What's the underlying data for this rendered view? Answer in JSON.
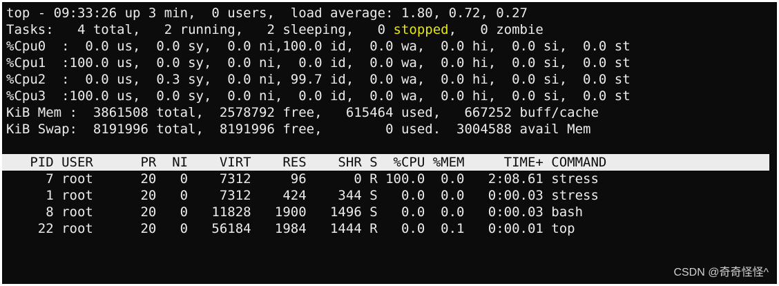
{
  "summary": {
    "line1": "top - 09:33:26 up 3 min,  0 users,  load average: 1.80, 0.72, 0.27",
    "tasks_pre": "Tasks:   4 total,   2 running,   2 sleeping,   0 ",
    "tasks_stopped": "stopped",
    "tasks_post": ",   0 zombie",
    "cpu": [
      "%Cpu0  :  0.0 us,  0.0 sy,  0.0 ni,100.0 id,  0.0 wa,  0.0 hi,  0.0 si,  0.0 st",
      "%Cpu1  :100.0 us,  0.0 sy,  0.0 ni,  0.0 id,  0.0 wa,  0.0 hi,  0.0 si,  0.0 st",
      "%Cpu2  :  0.0 us,  0.3 sy,  0.0 ni, 99.7 id,  0.0 wa,  0.0 hi,  0.0 si,  0.0 st",
      "%Cpu3  :100.0 us,  0.0 sy,  0.0 ni,  0.0 id,  0.0 wa,  0.0 hi,  0.0 si,  0.0 st"
    ],
    "mem": "KiB Mem :  3861508 total,  2578792 free,   615464 used,   667252 buff/cache",
    "swap": "KiB Swap:  8191996 total,  8191996 free,        0 used.  3004588 avail Mem"
  },
  "process_table": {
    "header": "   PID USER      PR  NI    VIRT    RES    SHR S  %CPU %MEM     TIME+ COMMAND",
    "rows": [
      "     7 root      20   0    7312     96      0 R 100.0  0.0   2:08.61 stress",
      "     1 root      20   0    7312    424    344 S   0.0  0.0   0:00.03 stress",
      "     8 root      20   0   11828   1900   1496 S   0.0  0.0   0:00.03 bash",
      "    22 root      20   0   56184   1984   1444 R   0.0  0.1   0:00.01 top"
    ]
  },
  "watermark": "CSDN @奇奇怪怪^",
  "colors": {
    "background": "#0c0c0c",
    "foreground": "#ececec",
    "stopped_highlight": "#e5e510"
  }
}
